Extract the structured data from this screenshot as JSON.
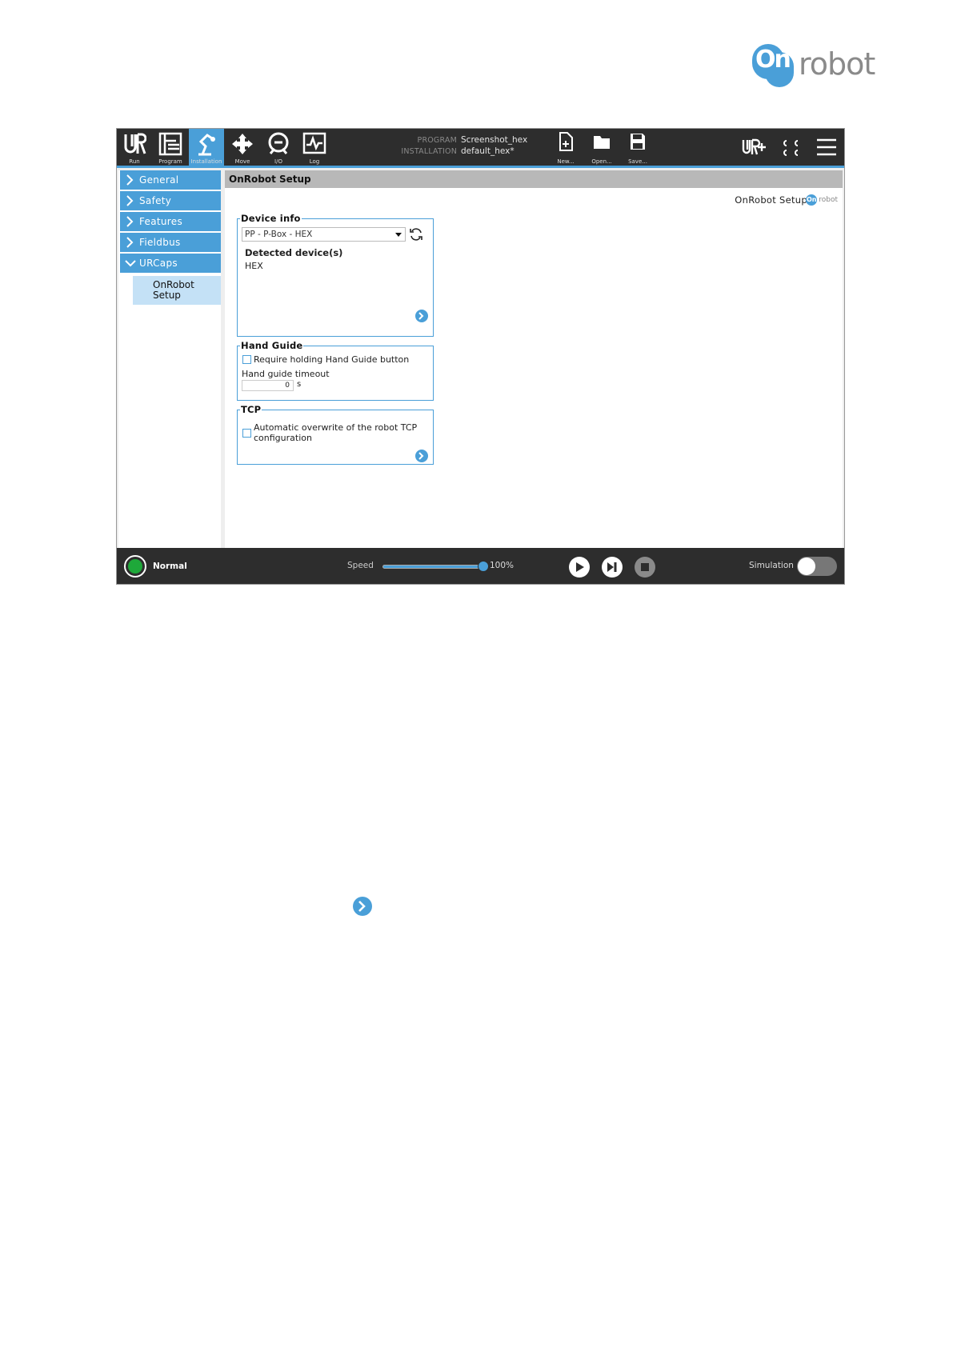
{
  "brand": {
    "logo_glyph": "On",
    "logo_word": "robot"
  },
  "topbar": {
    "nav": [
      {
        "label": "Run",
        "icon": "ur-logo-icon"
      },
      {
        "label": "Program",
        "icon": "program-icon"
      },
      {
        "label": "Installation",
        "icon": "installation-icon",
        "active": true
      },
      {
        "label": "Move",
        "icon": "move-icon"
      },
      {
        "label": "I/O",
        "icon": "io-icon"
      },
      {
        "label": "Log",
        "icon": "log-icon"
      }
    ],
    "program_key": "PROGRAM",
    "program_value": "Screenshot_hex",
    "installation_key": "INSTALLATION",
    "installation_value": "default_hex*",
    "file_buttons": [
      {
        "label": "New...",
        "icon": "new-file-icon"
      },
      {
        "label": "Open...",
        "icon": "folder-icon"
      },
      {
        "label": "Save...",
        "icon": "save-icon"
      }
    ],
    "right_icons": [
      "urplus-icon",
      "cc-icon",
      "hamburger-menu-icon"
    ],
    "cc_text": "c c\nc c"
  },
  "sidebar": {
    "items": [
      {
        "label": "General",
        "expanded": false
      },
      {
        "label": "Safety",
        "expanded": false
      },
      {
        "label": "Features",
        "expanded": false
      },
      {
        "label": "Fieldbus",
        "expanded": false
      },
      {
        "label": "URCaps",
        "expanded": true
      }
    ],
    "sub_item": {
      "line1": "OnRobot",
      "line2": "Setup"
    }
  },
  "main": {
    "header": "OnRobot Setup",
    "setup_title": "OnRobot Setup",
    "mini_logo_glyph": "On",
    "mini_logo_word": "robot",
    "device_info": {
      "title": "Device info",
      "selected": "PP - P-Box - HEX",
      "detected_label": "Detected device(s)",
      "detected_value": "HEX"
    },
    "hand_guide": {
      "title": "Hand Guide",
      "require_label": "Require holding Hand Guide button",
      "require_checked": false,
      "timeout_label": "Hand guide timeout",
      "timeout_value": "0",
      "timeout_unit": "s"
    },
    "tcp": {
      "title": "TCP",
      "overwrite_line1": "Automatic overwrite of the robot TCP",
      "overwrite_line2": "configuration",
      "overwrite_checked": false
    }
  },
  "bottombar": {
    "status": "Normal",
    "status_color": "#1ea83a",
    "speed_label": "Speed",
    "speed_value": "100%",
    "speed_fraction": 1.0,
    "simulation_label": "Simulation",
    "simulation_on": false
  },
  "colors": {
    "accent": "#4a9fd8",
    "bar": "#2d2d2d"
  }
}
